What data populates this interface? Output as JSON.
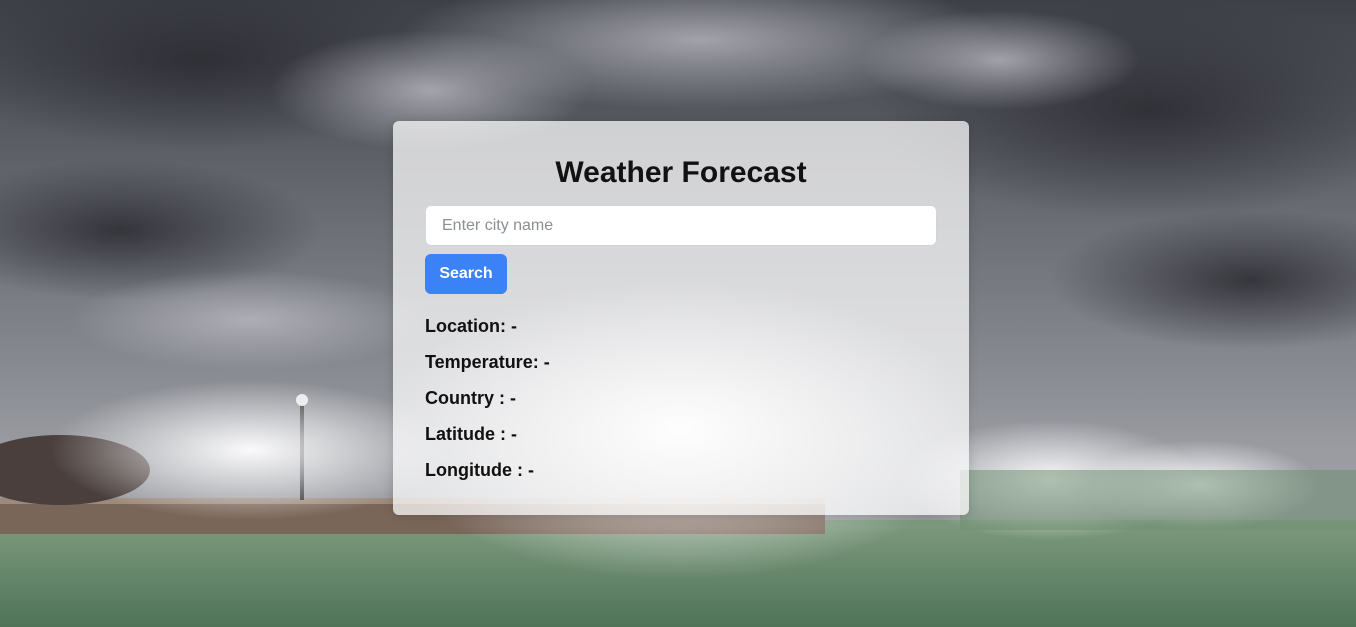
{
  "header": {
    "title": "Weather Forecast"
  },
  "search": {
    "placeholder": "Enter city name",
    "value": "",
    "button_label": "Search"
  },
  "results": [
    {
      "label": "Location: ",
      "value": "-"
    },
    {
      "label": "Temperature: ",
      "value": "-"
    },
    {
      "label": "Country : ",
      "value": "-"
    },
    {
      "label": "Latitude : ",
      "value": "-"
    },
    {
      "label": "Longitude : ",
      "value": "-"
    }
  ],
  "colors": {
    "accent": "#3b82f6",
    "card_background": "rgba(255,255,255,0.72)",
    "text": "#111111"
  }
}
